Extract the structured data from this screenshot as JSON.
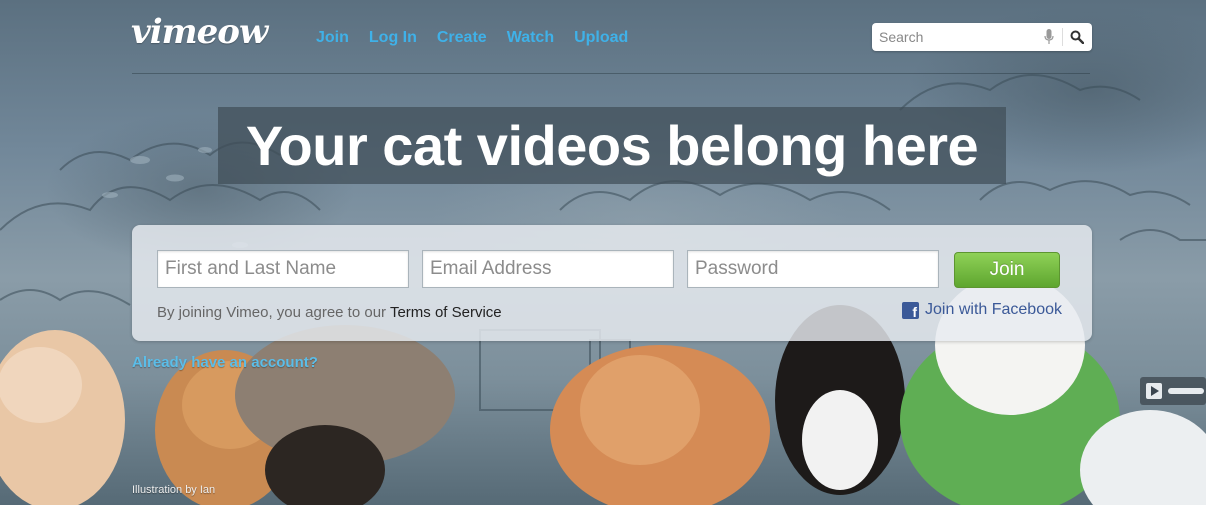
{
  "brand": {
    "logo_text": "vimeow"
  },
  "nav": {
    "items": [
      {
        "label": "Join"
      },
      {
        "label": "Log In"
      },
      {
        "label": "Create"
      },
      {
        "label": "Watch"
      },
      {
        "label": "Upload"
      }
    ]
  },
  "search": {
    "placeholder": "Search"
  },
  "hero": {
    "headline": "Your cat videos belong here"
  },
  "signup": {
    "name_placeholder": "First and Last Name",
    "email_placeholder": "Email Address",
    "password_placeholder": "Password",
    "join_label": "Join",
    "terms_prefix": "By joining Vimeo, you agree to our ",
    "terms_link": "Terms of Service",
    "facebook_label": "Join with Facebook"
  },
  "account_link": "Already have an account?",
  "credit": "Illustration by Ian",
  "colors": {
    "link_blue": "#3fb1e8",
    "join_green": "#6cb43a",
    "facebook_blue": "#3b5998"
  },
  "icons": [
    "search-icon",
    "microphone-icon",
    "facebook-icon",
    "play-icon"
  ]
}
